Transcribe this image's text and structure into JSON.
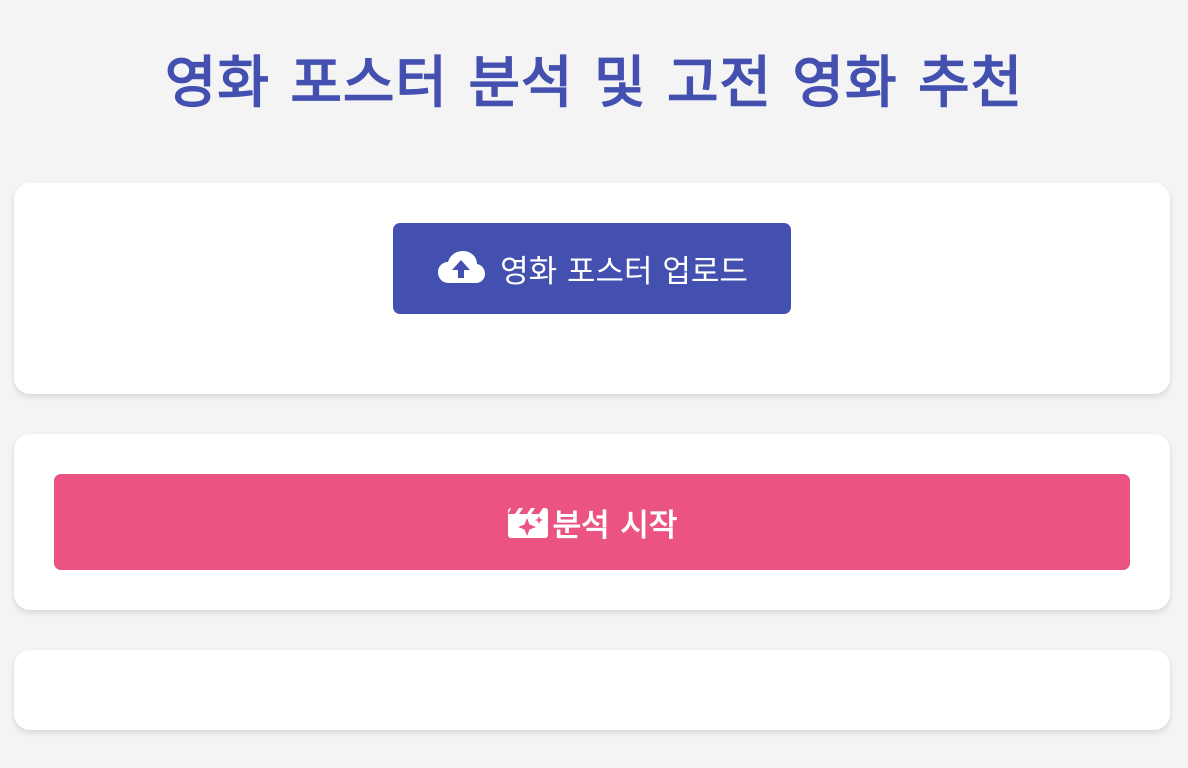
{
  "header": {
    "title": "영화 포스터 분석 및 고전 영화 추천"
  },
  "upload": {
    "button_label": "영화 포스터 업로드",
    "icon": "cloud-upload-icon"
  },
  "analyze": {
    "button_label": "분석 시작",
    "icon": "magic-clapperboard-icon"
  },
  "colors": {
    "primary": "#4450b0",
    "accent": "#ea5382",
    "background": "#f4f4f5",
    "card": "#ffffff"
  }
}
